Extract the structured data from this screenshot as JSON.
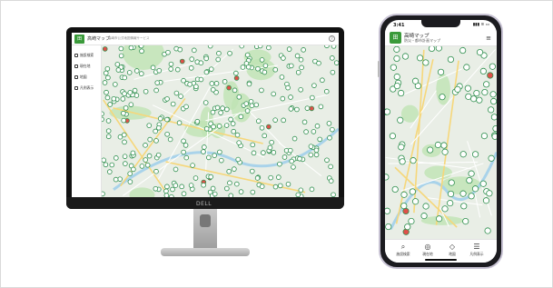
{
  "desktop": {
    "brand": "DELL",
    "header": {
      "logo_text": "田",
      "title": "高崎マップ",
      "subtitle": "高崎市公式地図情報サービス"
    },
    "sidebar": [
      {
        "label": "施設検索",
        "icon": "search-icon"
      },
      {
        "label": "現在地",
        "icon": "location-icon"
      },
      {
        "label": "地図",
        "icon": "map-icon"
      },
      {
        "label": "凡例表示",
        "icon": "legend-icon"
      }
    ],
    "help_label": "?"
  },
  "phone": {
    "status": {
      "time": "3:41",
      "signal": "▮▮▮ ≋ ▭"
    },
    "header": {
      "logo_text": "田",
      "title": "高崎マップ",
      "subtitle": "防災・都市計画マップ",
      "menu": "≡"
    },
    "bottom_nav": [
      {
        "label": "施設検索",
        "glyph": "⌕"
      },
      {
        "label": "現在地",
        "glyph": "◎"
      },
      {
        "label": "地図",
        "glyph": "◇"
      },
      {
        "label": "凡例表示",
        "glyph": "☰"
      }
    ]
  },
  "colors": {
    "accent": "#3a9a3a",
    "map_bg": "#e9eee6",
    "park": "#bfe3b4",
    "water": "#a9d3ea",
    "road": "#ffffff",
    "road_major": "#f6d77a",
    "pin": "#2f8f4e",
    "pin_red": "#e0504a"
  }
}
